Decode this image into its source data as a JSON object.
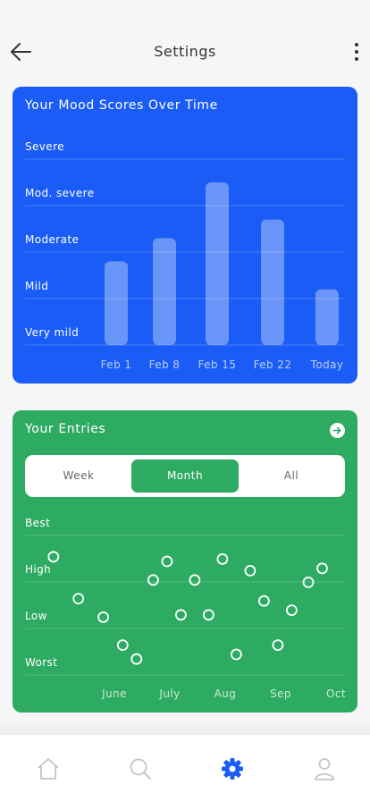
{
  "header": {
    "title": "Settings",
    "back_icon": "arrow-left-icon",
    "more_icon": "more-vertical-icon"
  },
  "mood_card": {
    "title": "Your Mood Scores Over Time",
    "color": "#1a5cf5",
    "chart_data": {
      "type": "bar",
      "categories": [
        "Feb 1",
        "Feb 8",
        "Feb 15",
        "Feb 22",
        "Today"
      ],
      "values": [
        1.8,
        2.3,
        3.5,
        2.7,
        1.2
      ],
      "y_levels": [
        "Very mild",
        "Mild",
        "Moderate",
        "Mod. severe",
        "Severe"
      ],
      "ylim": [
        0,
        4
      ],
      "grid": true
    }
  },
  "entries_card": {
    "title": "Your Entries",
    "color": "#2eab62",
    "link_icon": "arrow-right-circle-icon",
    "tabs": [
      {
        "label": "Week",
        "active": false
      },
      {
        "label": "Month",
        "active": true
      },
      {
        "label": "All",
        "active": false
      }
    ],
    "chart_data": {
      "type": "scatter",
      "x_labels": [
        "June",
        "July",
        "Aug",
        "Sep",
        "Oct"
      ],
      "y_levels": [
        "Worst",
        "Low",
        "High",
        "Best"
      ],
      "ylim": [
        0,
        3
      ],
      "grid": true,
      "points": [
        {
          "x": -1.1,
          "y": 2.35
        },
        {
          "x": -0.65,
          "y": 1.45
        },
        {
          "x": -0.2,
          "y": 1.05
        },
        {
          "x": 0.15,
          "y": 0.45
        },
        {
          "x": 0.4,
          "y": 0.15
        },
        {
          "x": 0.7,
          "y": 1.85
        },
        {
          "x": 0.95,
          "y": 2.25
        },
        {
          "x": 1.2,
          "y": 1.1
        },
        {
          "x": 1.45,
          "y": 1.85
        },
        {
          "x": 1.7,
          "y": 1.1
        },
        {
          "x": 1.95,
          "y": 2.3
        },
        {
          "x": 2.2,
          "y": 0.25
        },
        {
          "x": 2.45,
          "y": 2.05
        },
        {
          "x": 2.7,
          "y": 1.4
        },
        {
          "x": 2.95,
          "y": 0.45
        },
        {
          "x": 3.2,
          "y": 1.2
        },
        {
          "x": 3.5,
          "y": 1.8
        },
        {
          "x": 3.75,
          "y": 2.1
        }
      ]
    }
  },
  "bottom_nav": {
    "items": [
      {
        "icon": "home-icon",
        "active": false
      },
      {
        "icon": "search-icon",
        "active": false
      },
      {
        "icon": "gear-icon",
        "active": true
      },
      {
        "icon": "user-icon",
        "active": false
      }
    ],
    "active_color": "#1a5cf5",
    "inactive_color": "#c4c4c4"
  }
}
